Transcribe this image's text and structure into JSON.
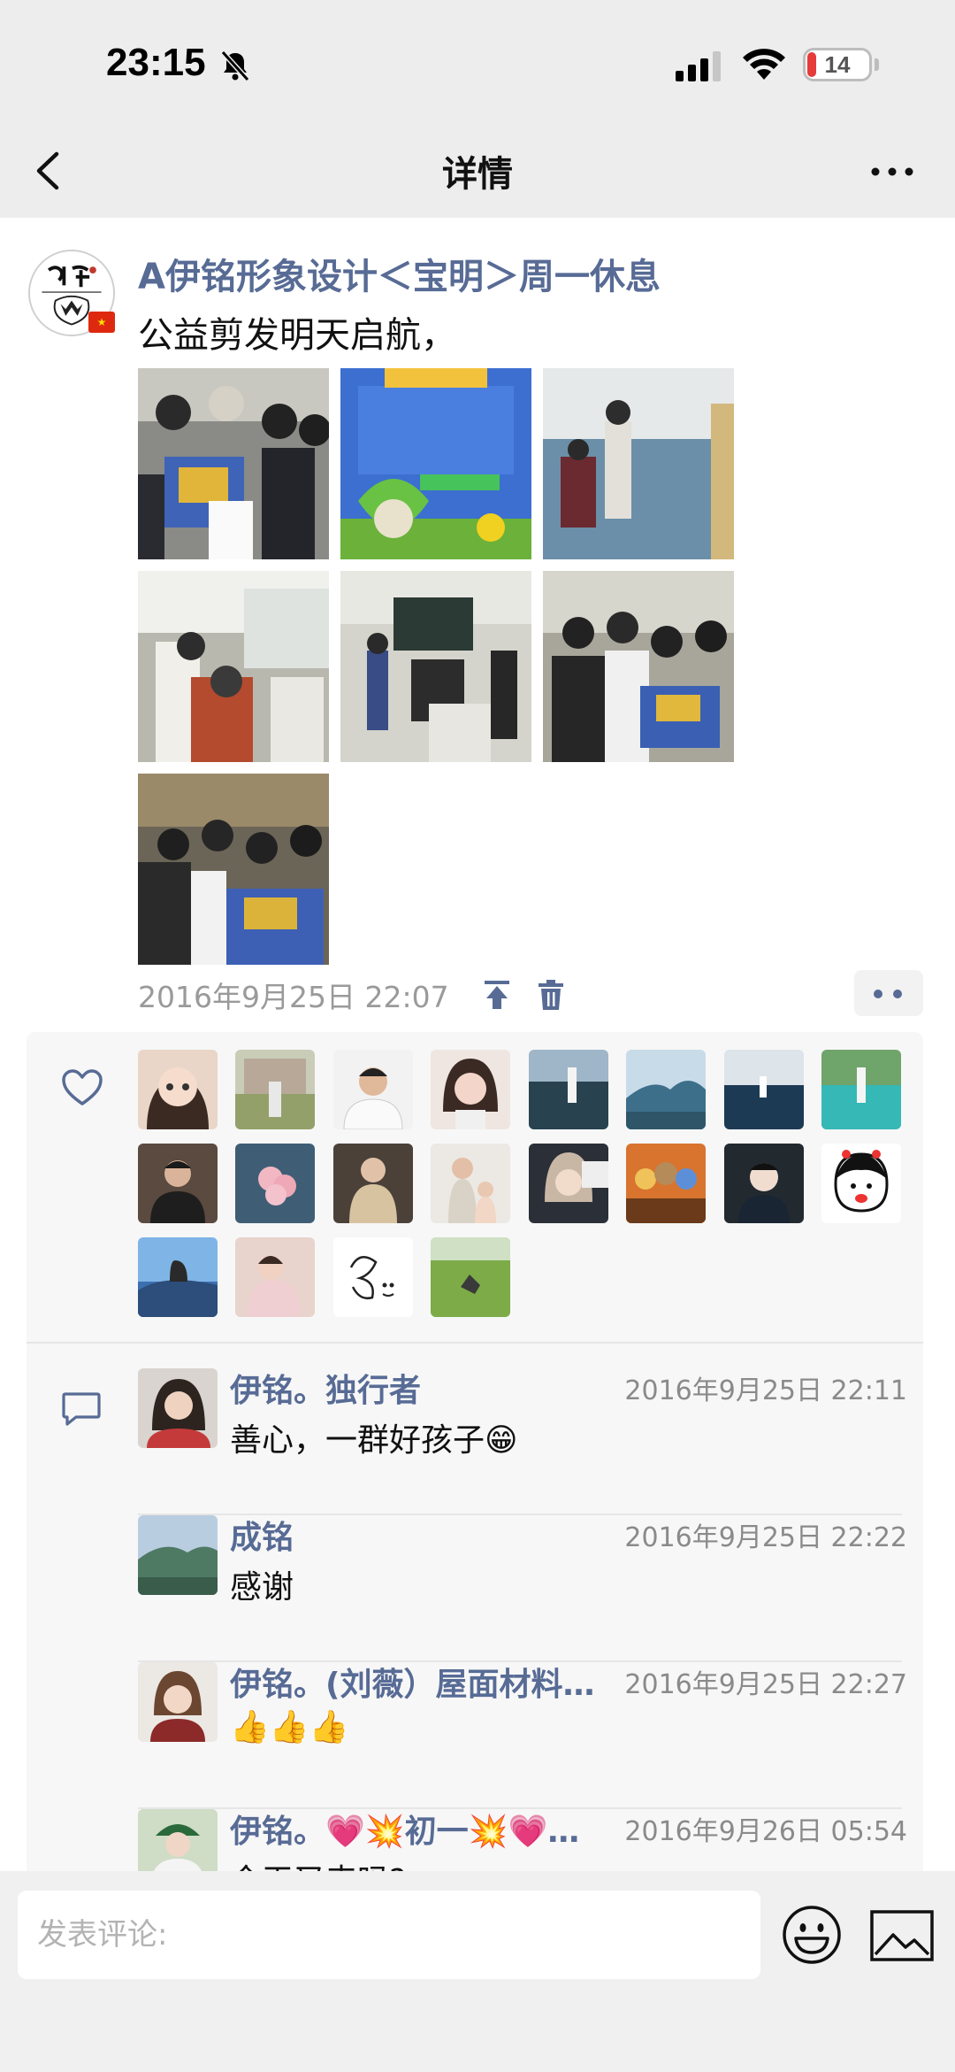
{
  "status_bar": {
    "time": "23:15",
    "battery": "14",
    "battery_level": 0.14
  },
  "nav": {
    "title": "详情"
  },
  "post": {
    "author": "A伊铭形象设计＜宝明＞周一休息",
    "text": "公益剪发明天启航，",
    "time": "2016年9月25日 22:07",
    "photo_count": 7
  },
  "likes": {
    "icon": "heart-icon",
    "count": 20
  },
  "comments": [
    {
      "name": "伊铭。独行者",
      "time": "2016年9月25日 22:11",
      "text": "善心，一群好孩子😁"
    },
    {
      "name": "成铭",
      "time": "2016年9月25日 22:22",
      "text": "感谢"
    },
    {
      "name": "伊铭。(刘薇）屋面材料…",
      "time": "2016年9月25日 22:27",
      "text": "👍👍👍"
    },
    {
      "name": "伊铭。💗💥初一💥💗…",
      "time": "2016年9月26日 05:54",
      "text": "今天又来吗?"
    }
  ],
  "input": {
    "placeholder": "发表评论:"
  },
  "colors": {
    "link": "#576b95",
    "status_bar_bg": "#ededed",
    "battery_low": "#e63b3b"
  }
}
